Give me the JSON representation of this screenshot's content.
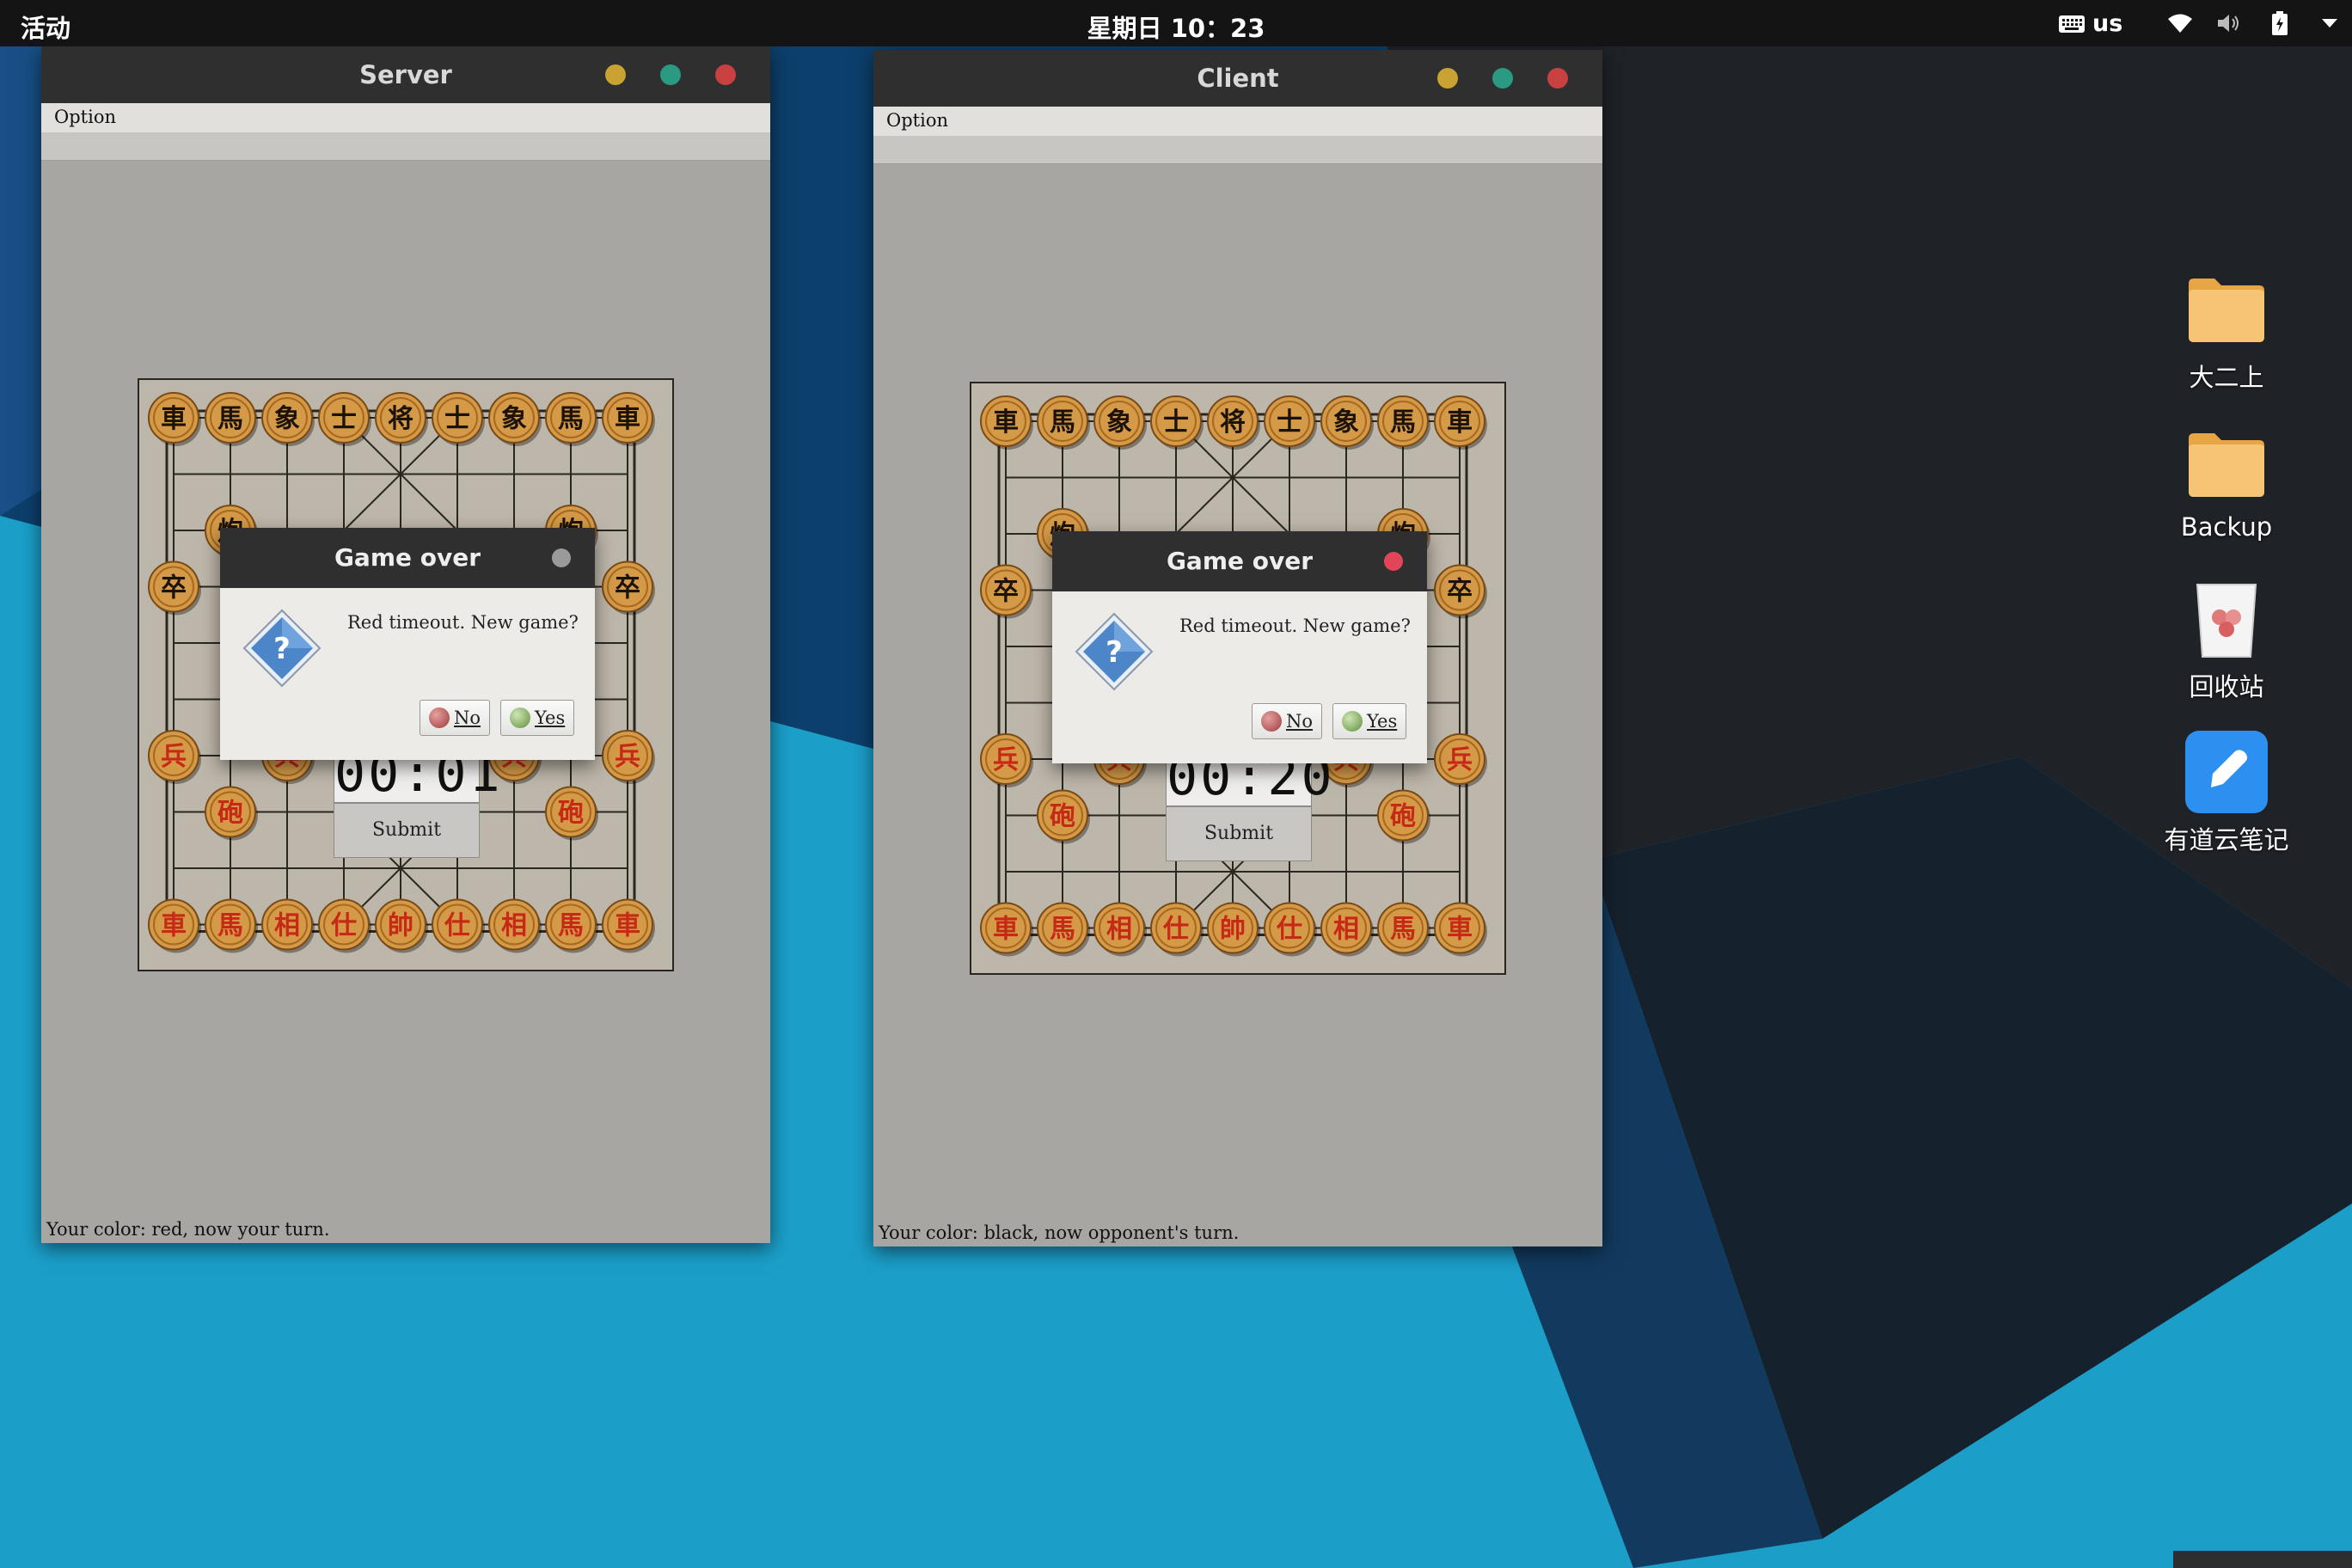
{
  "topbar": {
    "activities": "活动",
    "clock": "星期日 10：23",
    "keyboard_layout": "us",
    "icons": [
      "keyboard-icon",
      "wifi-icon",
      "volume-icon",
      "battery-icon",
      "chevron-down-icon"
    ]
  },
  "colors": {
    "titlebar": "#2f2f2f",
    "window_bg": "#a8a6a3",
    "board": "#bdb6aa",
    "piece_face": "#d49a48",
    "red_piece_text": "#c62a16",
    "black_piece_text": "#1c1208",
    "close_red": "#c8403f",
    "minimize_yellow": "#c9a232",
    "maximize_green": "#2a9a82",
    "desktop_blue": "#1b9fc9"
  },
  "server": {
    "title": "Server",
    "menu": "Option",
    "timer": "00:01",
    "submit": "Submit",
    "status": "Your color: red, now your turn.",
    "dialog": {
      "title": "Game over",
      "message": "Red timeout. New game?",
      "no": "No",
      "yes": "Yes",
      "icon": "question-icon",
      "close_color": "#9a9a9a"
    }
  },
  "client": {
    "title": "Client",
    "menu": "Option",
    "timer": "00:20",
    "submit": "Submit",
    "status": "Your color: black, now opponent's turn.",
    "dialog": {
      "title": "Game over",
      "message": "Red timeout. New game?",
      "no": "No",
      "yes": "Yes",
      "icon": "question-icon",
      "close_color": "#e2455a"
    }
  },
  "board": {
    "black_back_row": [
      "車",
      "馬",
      "象",
      "士",
      "将",
      "士",
      "象",
      "馬",
      "車"
    ],
    "black_cannon": "炮",
    "black_pawn": "卒",
    "red_pawn": "兵",
    "red_cannon": "砲",
    "red_back_row": [
      "車",
      "馬",
      "相",
      "仕",
      "帥",
      "仕",
      "相",
      "馬",
      "車"
    ]
  },
  "desktop": {
    "items": [
      {
        "label": "大二上",
        "icon": "folder-icon"
      },
      {
        "label": "Backup",
        "icon": "folder-icon"
      },
      {
        "label": "回收站",
        "icon": "trash-icon"
      },
      {
        "label": "有道云笔记",
        "icon": "note-app-icon"
      }
    ]
  }
}
